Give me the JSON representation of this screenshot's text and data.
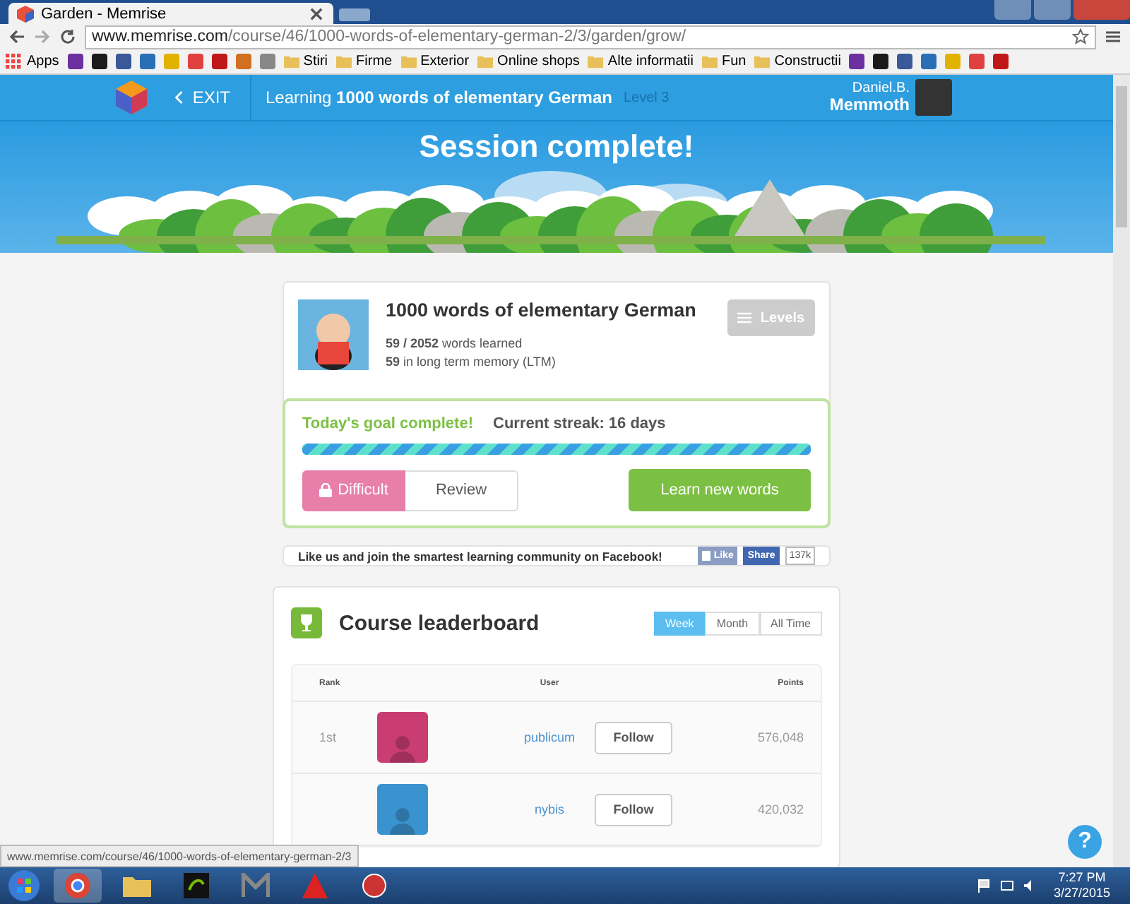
{
  "browser": {
    "tab_title": "Garden - Memrise",
    "url_host": "www.memrise.com",
    "url_path": "/course/46/1000-words-of-elementary-german-2/3/garden/grow/",
    "bookmarks": [
      {
        "kind": "apps",
        "label": "Apps"
      },
      {
        "kind": "icon"
      },
      {
        "kind": "icon"
      },
      {
        "kind": "icon"
      },
      {
        "kind": "icon"
      },
      {
        "kind": "icon"
      },
      {
        "kind": "icon"
      },
      {
        "kind": "icon"
      },
      {
        "kind": "icon"
      },
      {
        "kind": "icon"
      },
      {
        "kind": "folder",
        "label": "Stiri"
      },
      {
        "kind": "folder",
        "label": "Firme"
      },
      {
        "kind": "folder",
        "label": "Exterior"
      },
      {
        "kind": "folder",
        "label": "Online shops"
      },
      {
        "kind": "folder",
        "label": "Alte informatii"
      },
      {
        "kind": "folder",
        "label": "Fun"
      },
      {
        "kind": "folder",
        "label": "Constructii"
      },
      {
        "kind": "icon"
      },
      {
        "kind": "icon"
      },
      {
        "kind": "icon"
      },
      {
        "kind": "icon"
      },
      {
        "kind": "icon"
      },
      {
        "kind": "icon"
      },
      {
        "kind": "icon"
      }
    ]
  },
  "header": {
    "exit": "EXIT",
    "title": "Learning **1000 words of elementary German**",
    "level": "Level 3",
    "user_name": "Daniel.B.",
    "user_title": "Memmoth"
  },
  "hero": {
    "title": "Session complete!"
  },
  "course": {
    "name": "1000 words of elementary German",
    "stats": [
      "**59 / 2052** words learned",
      "**59** in long term memory (LTM)"
    ],
    "levels_button": "Levels"
  },
  "goal": {
    "status": "Today's goal complete!",
    "streak": "Current streak: 16 days",
    "level": 1,
    "difficult_button": "Difficult",
    "review_button": "Review",
    "learn_button": "Learn new words"
  },
  "facebook": {
    "text": "Like us and join the smartest learning community on Facebook!",
    "like": "Like",
    "share": "Share",
    "count": "137k"
  },
  "leaderboard": {
    "title": "Course leaderboard",
    "periods": [
      {
        "label": "Week",
        "selected": true
      },
      {
        "label": "Month",
        "selected": false
      },
      {
        "label": "All Time",
        "selected": false
      }
    ],
    "columns": [
      "Rank",
      "User",
      "Points"
    ],
    "rows": [
      {
        "rank": "1st",
        "user": "publicum",
        "follow": "Follow",
        "points": "576,048",
        "color": "#c93d72"
      },
      {
        "user": "nybis",
        "follow": "Follow",
        "points": "420,032",
        "color": "#3a93cf"
      }
    ]
  },
  "help_button": "?",
  "status_url": "www.memrise.com/course/46/1000-words-of-elementary-german-2/3",
  "taskbar": {
    "time": "7:27 PM",
    "date": "3/27/2015"
  }
}
